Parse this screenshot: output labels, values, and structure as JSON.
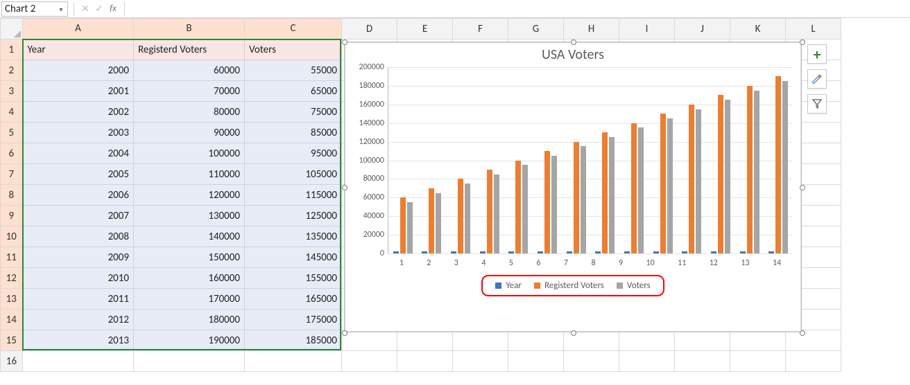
{
  "formula_bar": {
    "name_box_value": "Chart 2",
    "cancel_glyph": "✕",
    "confirm_glyph": "✓",
    "fx_label": "fx",
    "formula_value": ""
  },
  "columns": [
    "A",
    "B",
    "C",
    "D",
    "E",
    "F",
    "G",
    "H",
    "I",
    "J",
    "K",
    "L"
  ],
  "row_numbers": [
    "1",
    "2",
    "3",
    "4",
    "5",
    "6",
    "7",
    "8",
    "9",
    "10",
    "11",
    "12",
    "13",
    "14",
    "15",
    "16"
  ],
  "table": {
    "headers": {
      "A": "Year",
      "B": "Registerd Voters",
      "C": "Voters"
    },
    "rows": [
      {
        "A": "2000",
        "B": "60000",
        "C": "55000"
      },
      {
        "A": "2001",
        "B": "70000",
        "C": "65000"
      },
      {
        "A": "2002",
        "B": "80000",
        "C": "75000"
      },
      {
        "A": "2003",
        "B": "90000",
        "C": "85000"
      },
      {
        "A": "2004",
        "B": "100000",
        "C": "95000"
      },
      {
        "A": "2005",
        "B": "110000",
        "C": "105000"
      },
      {
        "A": "2006",
        "B": "120000",
        "C": "115000"
      },
      {
        "A": "2007",
        "B": "130000",
        "C": "125000"
      },
      {
        "A": "2008",
        "B": "140000",
        "C": "135000"
      },
      {
        "A": "2009",
        "B": "150000",
        "C": "145000"
      },
      {
        "A": "2010",
        "B": "160000",
        "C": "155000"
      },
      {
        "A": "2011",
        "B": "170000",
        "C": "165000"
      },
      {
        "A": "2012",
        "B": "180000",
        "C": "175000"
      },
      {
        "A": "2013",
        "B": "190000",
        "C": "185000"
      }
    ]
  },
  "chart": {
    "title": "USA Voters",
    "y_ticks": [
      "0",
      "20000",
      "40000",
      "60000",
      "80000",
      "100000",
      "120000",
      "140000",
      "160000",
      "180000",
      "200000"
    ],
    "categories": [
      "1",
      "2",
      "3",
      "4",
      "5",
      "6",
      "7",
      "8",
      "9",
      "10",
      "11",
      "12",
      "13",
      "14"
    ],
    "legend": {
      "year": "Year",
      "reg": "Registerd Voters",
      "vot": "Voters"
    }
  },
  "side_buttons": {
    "plus": "+",
    "brush": "✎",
    "filter": "▾"
  },
  "chart_data": {
    "type": "bar",
    "title": "USA Voters",
    "xlabel": "",
    "ylabel": "",
    "ylim": [
      0,
      200000
    ],
    "categories": [
      "1",
      "2",
      "3",
      "4",
      "5",
      "6",
      "7",
      "8",
      "9",
      "10",
      "11",
      "12",
      "13",
      "14"
    ],
    "series": [
      {
        "name": "Year",
        "values": [
          2000,
          2001,
          2002,
          2003,
          2004,
          2005,
          2006,
          2007,
          2008,
          2009,
          2010,
          2011,
          2012,
          2013
        ]
      },
      {
        "name": "Registerd Voters",
        "values": [
          60000,
          70000,
          80000,
          90000,
          100000,
          110000,
          120000,
          130000,
          140000,
          150000,
          160000,
          170000,
          180000,
          190000
        ]
      },
      {
        "name": "Voters",
        "values": [
          55000,
          65000,
          75000,
          85000,
          95000,
          105000,
          115000,
          125000,
          135000,
          145000,
          155000,
          165000,
          175000,
          185000
        ]
      }
    ]
  }
}
